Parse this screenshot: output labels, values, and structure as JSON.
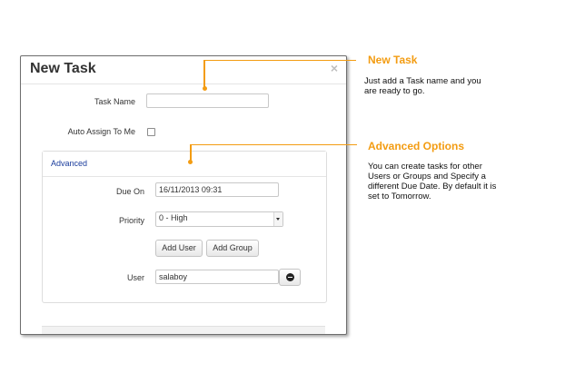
{
  "dialog": {
    "title": "New Task",
    "close_symbol": "×",
    "task_name_label": "Task Name",
    "task_name_value": "",
    "auto_assign_label": "Auto Assign To Me",
    "auto_assign_checked": false
  },
  "advanced": {
    "title": "Advanced",
    "due_on_label": "Due On",
    "due_on_value": "16/11/2013 09:31",
    "priority_label": "Priority",
    "priority_value": "0 - High",
    "add_user_label": "Add User",
    "add_group_label": "Add Group",
    "user_label": "User",
    "user_value": "salaboy"
  },
  "callouts": {
    "new_task": {
      "title": "New Task",
      "text": "Just add a Task name and you are ready to go."
    },
    "advanced_options": {
      "title": "Advanced Options",
      "text": "You can create tasks for other Users or Groups and Specify a different Due Date. By default it is set to Tomorrow."
    }
  },
  "colors": {
    "accent": "#f39c12",
    "link": "#1a3c9c"
  },
  "icons": {
    "close": "close-icon",
    "dropdown": "chevron-down-icon",
    "remove": "minus-circle-icon"
  }
}
